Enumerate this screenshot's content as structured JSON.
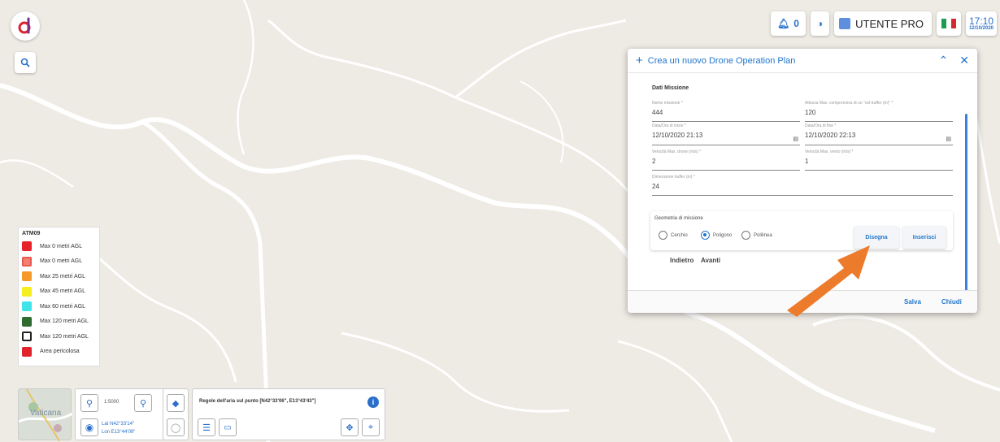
{
  "header": {
    "notifications_count": "0",
    "user_label": "UTENTE PRO",
    "time": "17:10",
    "date": "12/10/2020"
  },
  "legend": {
    "title": "ATM09",
    "items": [
      {
        "label": "Max 0 metri AGL",
        "color": "#e8222a",
        "style": "solid"
      },
      {
        "label": "Max 0 metri AGL",
        "color": "#f08070",
        "style": "hatched"
      },
      {
        "label": "Max 25 metri AGL",
        "color": "#f59a2a",
        "style": "solid"
      },
      {
        "label": "Max 45 metri AGL",
        "color": "#f5ef21",
        "style": "solid"
      },
      {
        "label": "Max 60 metri AGL",
        "color": "#3fe3e8",
        "style": "solid"
      },
      {
        "label": "Max 120 metri AGL",
        "color": "#2e6b2e",
        "style": "solid"
      },
      {
        "label": "Max 120 metri AGL",
        "color": "#ffffff",
        "style": "outline"
      },
      {
        "label": "Area pericolosa",
        "color": "#e0222a",
        "style": "solid"
      }
    ]
  },
  "panel": {
    "title": "Crea un nuovo Drone Operation Plan",
    "section_title": "Dati Missione",
    "fields": {
      "nome": {
        "label": "Nome missione *",
        "value": "444"
      },
      "altezza": {
        "label": "Altezza Max. comprensiva di un \"ost buffer (m)\" *",
        "value": "120"
      },
      "data_inizio": {
        "label": "Data/Ora di inizio *",
        "value": "12/10/2020 21:13"
      },
      "data_fine": {
        "label": "Data/Ora di fine *",
        "value": "12/10/2020 22:13"
      },
      "vel_drone": {
        "label": "Velocità Max. drone (m/s) *",
        "value": "2"
      },
      "vel_vento": {
        "label": "Velocità Max. vento (m/s) *",
        "value": "1"
      },
      "dimensione": {
        "label": "Dimensione buffer (m) *",
        "value": "24"
      }
    },
    "geometry": {
      "label": "Geometria di missione",
      "options": [
        "Cerchio",
        "Poligono",
        "Polilinea"
      ],
      "selected": "Poligono",
      "draw_label": "Disegna",
      "insert_label": "Inserisci"
    },
    "back_label": "Indietro",
    "next_label": "Avanti",
    "save_label": "Salva",
    "close_label": "Chiudi"
  },
  "map_labels": {
    "place": "Vaticana"
  },
  "bottom": {
    "scale": "1:5000",
    "lat": "Lat N42°33'14\"",
    "lon": "Lon E13°44'09\"",
    "rules_text": "Regole dell'aria sul punto [N42°33'06\", E13°43'43\"]"
  },
  "colors": {
    "accent": "#2277cc",
    "arrow": "#ec7b2c"
  }
}
